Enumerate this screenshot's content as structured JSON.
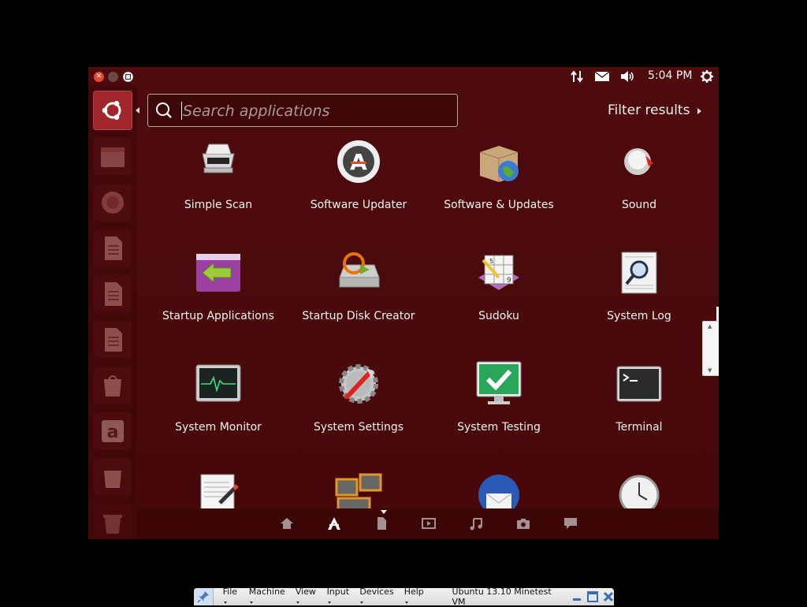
{
  "top_panel": {
    "clock": "5:04 PM",
    "indicators": [
      "network-icon",
      "mail-icon",
      "sound-icon",
      "power-icon"
    ]
  },
  "dash": {
    "search_placeholder": "Search applications",
    "filter_label": "Filter results"
  },
  "apps": [
    {
      "label": "Simple Scan",
      "icon": "scanner-icon"
    },
    {
      "label": "Software Updater",
      "icon": "software-updater-icon"
    },
    {
      "label": "Software & Updates",
      "icon": "software-updates-icon"
    },
    {
      "label": "Sound",
      "icon": "sound-settings-icon"
    },
    {
      "label": "Startup Applications",
      "icon": "startup-applications-icon"
    },
    {
      "label": "Startup Disk Creator",
      "icon": "startup-disk-creator-icon"
    },
    {
      "label": "Sudoku",
      "icon": "sudoku-icon"
    },
    {
      "label": "System Log",
      "icon": "system-log-icon"
    },
    {
      "label": "System Monitor",
      "icon": "system-monitor-icon"
    },
    {
      "label": "System Settings",
      "icon": "system-settings-icon"
    },
    {
      "label": "System Testing",
      "icon": "system-testing-icon"
    },
    {
      "label": "Terminal",
      "icon": "terminal-icon"
    },
    {
      "label": "",
      "icon": "text-editor-icon"
    },
    {
      "label": "",
      "icon": "workspaces-icon"
    },
    {
      "label": "",
      "icon": "thunderbird-icon"
    },
    {
      "label": "",
      "icon": "clock-icon"
    }
  ],
  "lenses": [
    "home-lens-icon",
    "applications-lens-icon",
    "files-lens-icon",
    "video-lens-icon",
    "music-lens-icon",
    "photo-lens-icon",
    "social-lens-icon"
  ],
  "vbox": {
    "menus": [
      "File",
      "Machine",
      "View",
      "Input",
      "Devices",
      "Help"
    ],
    "vm_name": "Ubuntu 13.10 Minetest VM"
  }
}
